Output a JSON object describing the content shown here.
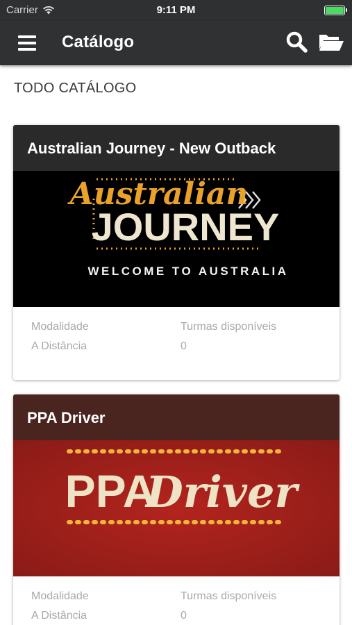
{
  "status_bar": {
    "carrier": "Carrier",
    "time": "9:11 PM",
    "battery_color": "#4cd964"
  },
  "app_bar": {
    "title": "Catálogo",
    "background": "#303132",
    "icons": [
      "menu-icon",
      "search-icon",
      "folder-open-icon"
    ]
  },
  "section": {
    "title": "TODO CATÁLOGO"
  },
  "courses": [
    {
      "title": "Australian Journey - New Outback",
      "image": {
        "line1": "Australian",
        "line2": "JOURNEY",
        "tagline": "WELCOME TO AUSTRALIA"
      },
      "modality_label": "Modalidade",
      "modality_value": "A Distância",
      "classes_label": "Turmas disponíveis",
      "classes_value": "0"
    },
    {
      "title": "PPA Driver",
      "image": {
        "line1": "PPA",
        "line2": "Driver"
      },
      "modality_label": "Modalidade",
      "modality_value": "A Distância",
      "classes_label": "Turmas disponíveis",
      "classes_value": "0"
    }
  ]
}
